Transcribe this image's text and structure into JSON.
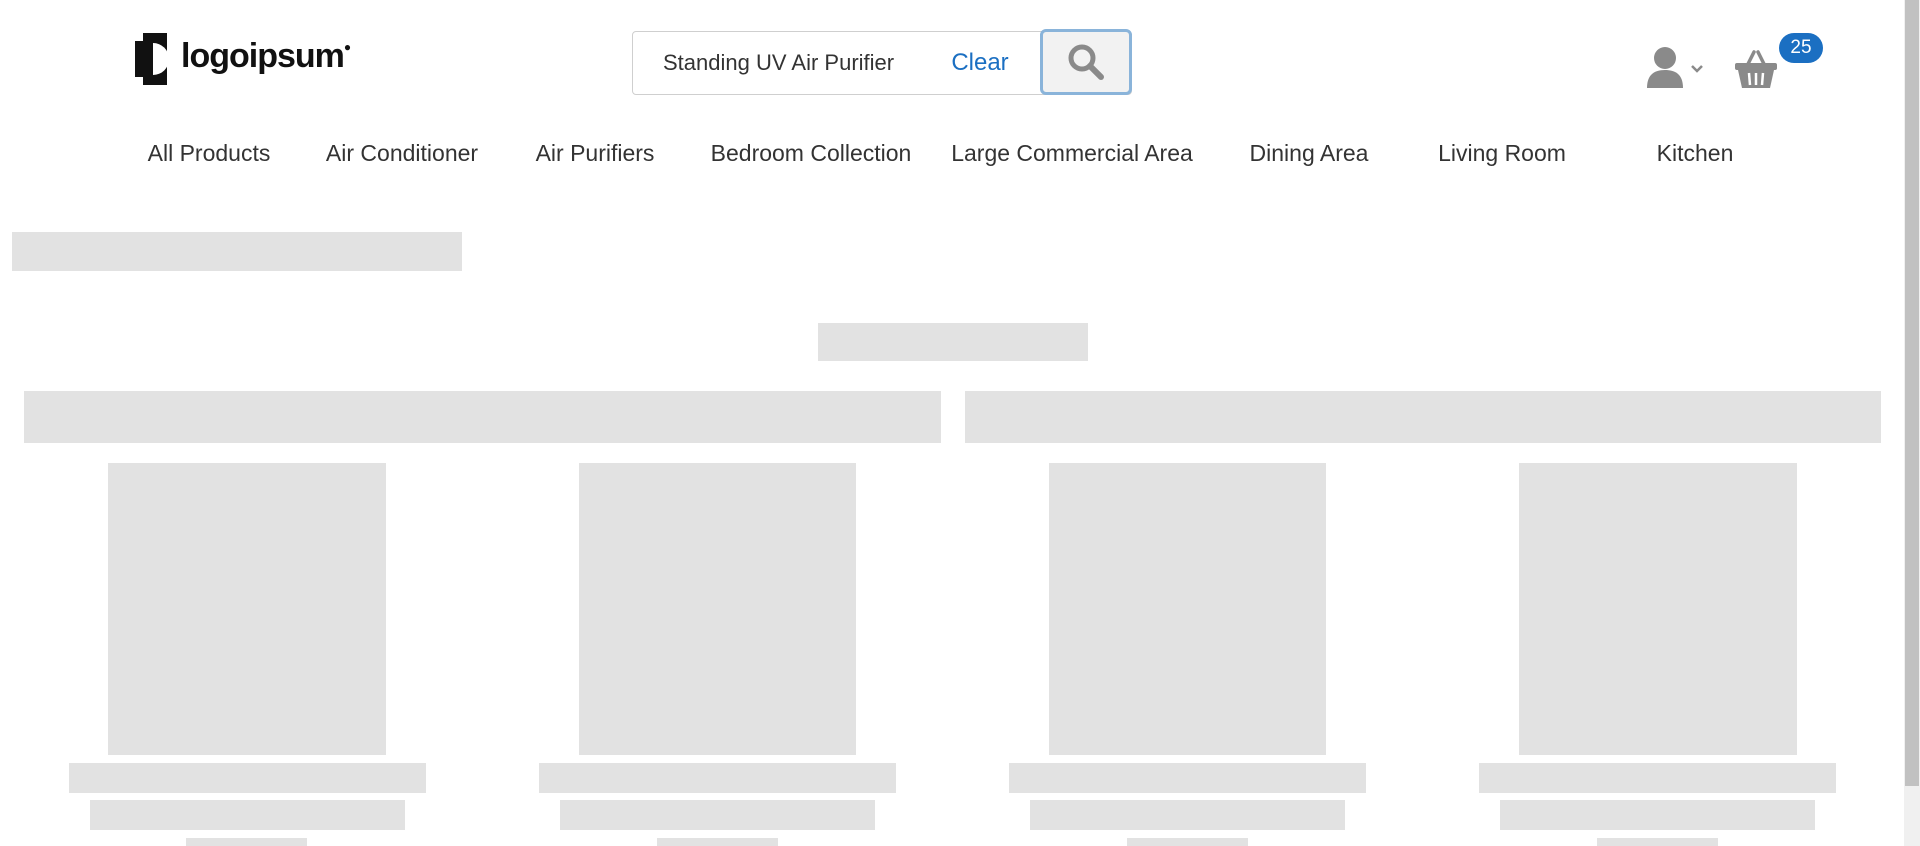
{
  "header": {
    "logo_text": "logoipsum",
    "search": {
      "value": "Standing UV Air Purifier",
      "placeholder": "Search",
      "clear_label": "Clear",
      "icon": "search-icon"
    },
    "account_icon": "user-icon",
    "cart": {
      "icon": "basket-icon",
      "count": "25"
    }
  },
  "nav": {
    "items": [
      {
        "label": "All Products"
      },
      {
        "label": "Air Conditioner"
      },
      {
        "label": "Air Purifiers"
      },
      {
        "label": "Bedroom Collection"
      },
      {
        "label": "Large Commercial Area"
      },
      {
        "label": "Dining Area"
      },
      {
        "label": "Living Room"
      },
      {
        "label": "Kitchen"
      }
    ]
  },
  "colors": {
    "accent": "#1b6fc2",
    "skeleton": "#e2e2e2",
    "text": "#333333",
    "icon": "#8a8a8a"
  }
}
